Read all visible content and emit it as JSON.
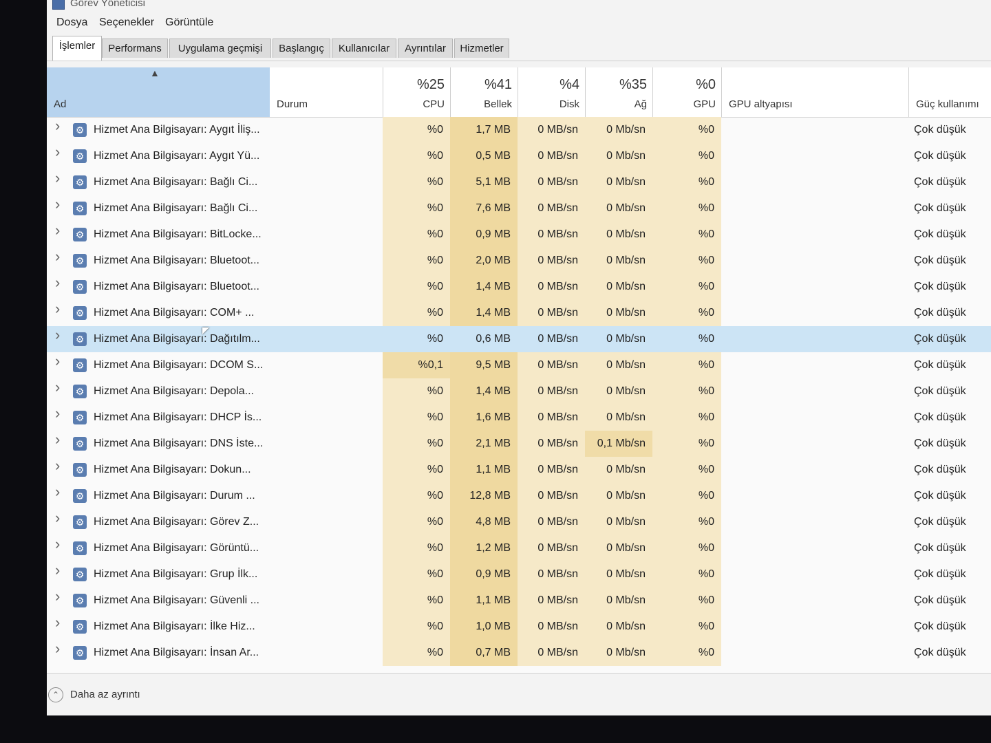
{
  "window": {
    "title": "Görev Yöneticisi"
  },
  "menu": [
    "Dosya",
    "Seçenekler",
    "Görüntüle"
  ],
  "tabs": [
    "İşlemler",
    "Performans",
    "Uygulama geçmişi",
    "Başlangıç",
    "Kullanıcılar",
    "Ayrıntılar",
    "Hizmetler"
  ],
  "active_tab": "İşlemler",
  "columns": {
    "name": "Ad",
    "status": "Durum",
    "cpu": {
      "pct": "%25",
      "label": "CPU"
    },
    "memory": {
      "pct": "%41",
      "label": "Bellek"
    },
    "disk": {
      "pct": "%4",
      "label": "Disk"
    },
    "network": {
      "pct": "%35",
      "label": "Ağ"
    },
    "gpu": {
      "pct": "%0",
      "label": "GPU"
    },
    "gpu_engine": "GPU altyapısı",
    "power": "Güç kullanımı"
  },
  "rows": [
    {
      "name": "Hizmet Ana Bilgisayarı: Aygıt İliş...",
      "cpu": "%0",
      "mem": "1,7 MB",
      "disk": "0 MB/sn",
      "net": "0 Mb/sn",
      "gpu": "%0",
      "power": "Çok düşük"
    },
    {
      "name": "Hizmet Ana Bilgisayarı: Aygıt Yü...",
      "cpu": "%0",
      "mem": "0,5 MB",
      "disk": "0 MB/sn",
      "net": "0 Mb/sn",
      "gpu": "%0",
      "power": "Çok düşük"
    },
    {
      "name": "Hizmet Ana Bilgisayarı: Bağlı Ci...",
      "cpu": "%0",
      "mem": "5,1 MB",
      "disk": "0 MB/sn",
      "net": "0 Mb/sn",
      "gpu": "%0",
      "power": "Çok düşük"
    },
    {
      "name": "Hizmet Ana Bilgisayarı: Bağlı Ci...",
      "cpu": "%0",
      "mem": "7,6 MB",
      "disk": "0 MB/sn",
      "net": "0 Mb/sn",
      "gpu": "%0",
      "power": "Çok düşük"
    },
    {
      "name": "Hizmet Ana Bilgisayarı: BitLocke...",
      "cpu": "%0",
      "mem": "0,9 MB",
      "disk": "0 MB/sn",
      "net": "0 Mb/sn",
      "gpu": "%0",
      "power": "Çok düşük"
    },
    {
      "name": "Hizmet Ana Bilgisayarı: Bluetoot...",
      "cpu": "%0",
      "mem": "2,0 MB",
      "disk": "0 MB/sn",
      "net": "0 Mb/sn",
      "gpu": "%0",
      "power": "Çok düşük"
    },
    {
      "name": "Hizmet Ana Bilgisayarı: Bluetoot...",
      "cpu": "%0",
      "mem": "1,4 MB",
      "disk": "0 MB/sn",
      "net": "0 Mb/sn",
      "gpu": "%0",
      "power": "Çok düşük"
    },
    {
      "name": "Hizmet Ana Bilgisayarı: COM+ ...",
      "cpu": "%0",
      "mem": "1,4 MB",
      "disk": "0 MB/sn",
      "net": "0 Mb/sn",
      "gpu": "%0",
      "power": "Çok düşük"
    },
    {
      "name": "Hizmet Ana Bilgisayarı: Dağıtılm...",
      "cpu": "%0",
      "mem": "0,6 MB",
      "disk": "0 MB/sn",
      "net": "0 Mb/sn",
      "gpu": "%0",
      "power": "Çok düşük",
      "selected": true
    },
    {
      "name": "Hizmet Ana Bilgisayarı: DCOM S...",
      "cpu": "%0,1",
      "mem": "9,5 MB",
      "disk": "0 MB/sn",
      "net": "0 Mb/sn",
      "gpu": "%0",
      "power": "Çok düşük"
    },
    {
      "name": "Hizmet Ana Bilgisayarı: Depola...",
      "cpu": "%0",
      "mem": "1,4 MB",
      "disk": "0 MB/sn",
      "net": "0 Mb/sn",
      "gpu": "%0",
      "power": "Çok düşük"
    },
    {
      "name": "Hizmet Ana Bilgisayarı: DHCP İs...",
      "cpu": "%0",
      "mem": "1,6 MB",
      "disk": "0 MB/sn",
      "net": "0 Mb/sn",
      "gpu": "%0",
      "power": "Çok düşük"
    },
    {
      "name": "Hizmet Ana Bilgisayarı: DNS İste...",
      "cpu": "%0",
      "mem": "2,1 MB",
      "disk": "0 MB/sn",
      "net": "0,1 Mb/sn",
      "gpu": "%0",
      "power": "Çok düşük"
    },
    {
      "name": "Hizmet Ana Bilgisayarı: Dokun...",
      "cpu": "%0",
      "mem": "1,1 MB",
      "disk": "0 MB/sn",
      "net": "0 Mb/sn",
      "gpu": "%0",
      "power": "Çok düşük"
    },
    {
      "name": "Hizmet Ana Bilgisayarı: Durum ...",
      "cpu": "%0",
      "mem": "12,8 MB",
      "disk": "0 MB/sn",
      "net": "0 Mb/sn",
      "gpu": "%0",
      "power": "Çok düşük"
    },
    {
      "name": "Hizmet Ana Bilgisayarı: Görev Z...",
      "cpu": "%0",
      "mem": "4,8 MB",
      "disk": "0 MB/sn",
      "net": "0 Mb/sn",
      "gpu": "%0",
      "power": "Çok düşük"
    },
    {
      "name": "Hizmet Ana Bilgisayarı: Görüntü...",
      "cpu": "%0",
      "mem": "1,2 MB",
      "disk": "0 MB/sn",
      "net": "0 Mb/sn",
      "gpu": "%0",
      "power": "Çok düşük"
    },
    {
      "name": "Hizmet Ana Bilgisayarı: Grup İlk...",
      "cpu": "%0",
      "mem": "0,9 MB",
      "disk": "0 MB/sn",
      "net": "0 Mb/sn",
      "gpu": "%0",
      "power": "Çok düşük"
    },
    {
      "name": "Hizmet Ana Bilgisayarı: Güvenli ...",
      "cpu": "%0",
      "mem": "1,1 MB",
      "disk": "0 MB/sn",
      "net": "0 Mb/sn",
      "gpu": "%0",
      "power": "Çok düşük"
    },
    {
      "name": "Hizmet Ana Bilgisayarı: İlke Hiz...",
      "cpu": "%0",
      "mem": "1,0 MB",
      "disk": "0 MB/sn",
      "net": "0 Mb/sn",
      "gpu": "%0",
      "power": "Çok düşük"
    },
    {
      "name": "Hizmet Ana Bilgisayarı: İnsan Ar...",
      "cpu": "%0",
      "mem": "0,7 MB",
      "disk": "0 MB/sn",
      "net": "0 Mb/sn",
      "gpu": "%0",
      "power": "Çok düşük"
    }
  ],
  "footer": {
    "label": "Daha az ayrıntı",
    "icon": "chevron-up-circle-icon"
  },
  "colors": {
    "selected_row": "#cce4f5",
    "sorted_header": "#b7d3ee",
    "heat": "#f6e9c8",
    "memory_heat": "#efd9a0"
  }
}
